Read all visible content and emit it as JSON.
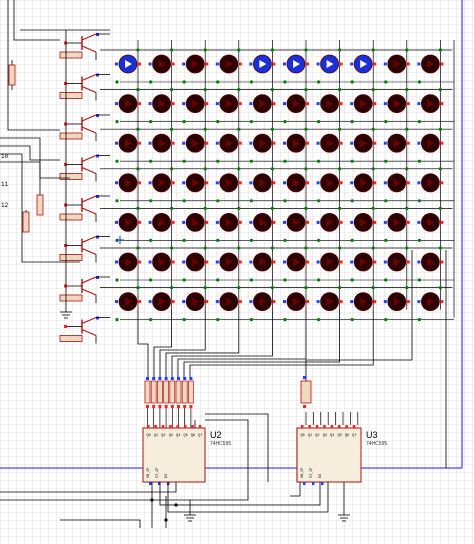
{
  "canvas": {
    "background": "#ffffff",
    "grid_color": "#c8c8c8",
    "wire_color": "#000000",
    "border_color": "#0000ff",
    "component_color": "#b01010",
    "chip_fill": "#f6eedb",
    "led_off_color": "#2a0000",
    "led_on_color": "#1a2fd8",
    "junction_color": "#008000",
    "pin_blue": "#2040ff",
    "pin_red": "#ff2020"
  },
  "led_matrix": {
    "rows": 7,
    "cols": 10,
    "lit_row": 0,
    "lit_cols": [
      0,
      4,
      5,
      6,
      7
    ]
  },
  "chips": [
    {
      "ref": "U2",
      "part": "74HC595",
      "pins_top": [
        "Q0",
        "Q1",
        "Q2",
        "Q3",
        "Q4",
        "Q5",
        "Q6",
        "Q7"
      ],
      "pins_bottom": [
        "SH_CP",
        "ST_CP",
        "DS"
      ]
    },
    {
      "ref": "U3",
      "part": "74HC595",
      "pins_top": [
        "Q0",
        "Q1",
        "Q2",
        "Q3",
        "Q4",
        "Q5",
        "Q6",
        "Q7"
      ],
      "pins_bottom": [
        "SH_CP",
        "ST_CP",
        "DS"
      ]
    }
  ],
  "side_labels": [
    "10",
    "11",
    "12"
  ]
}
